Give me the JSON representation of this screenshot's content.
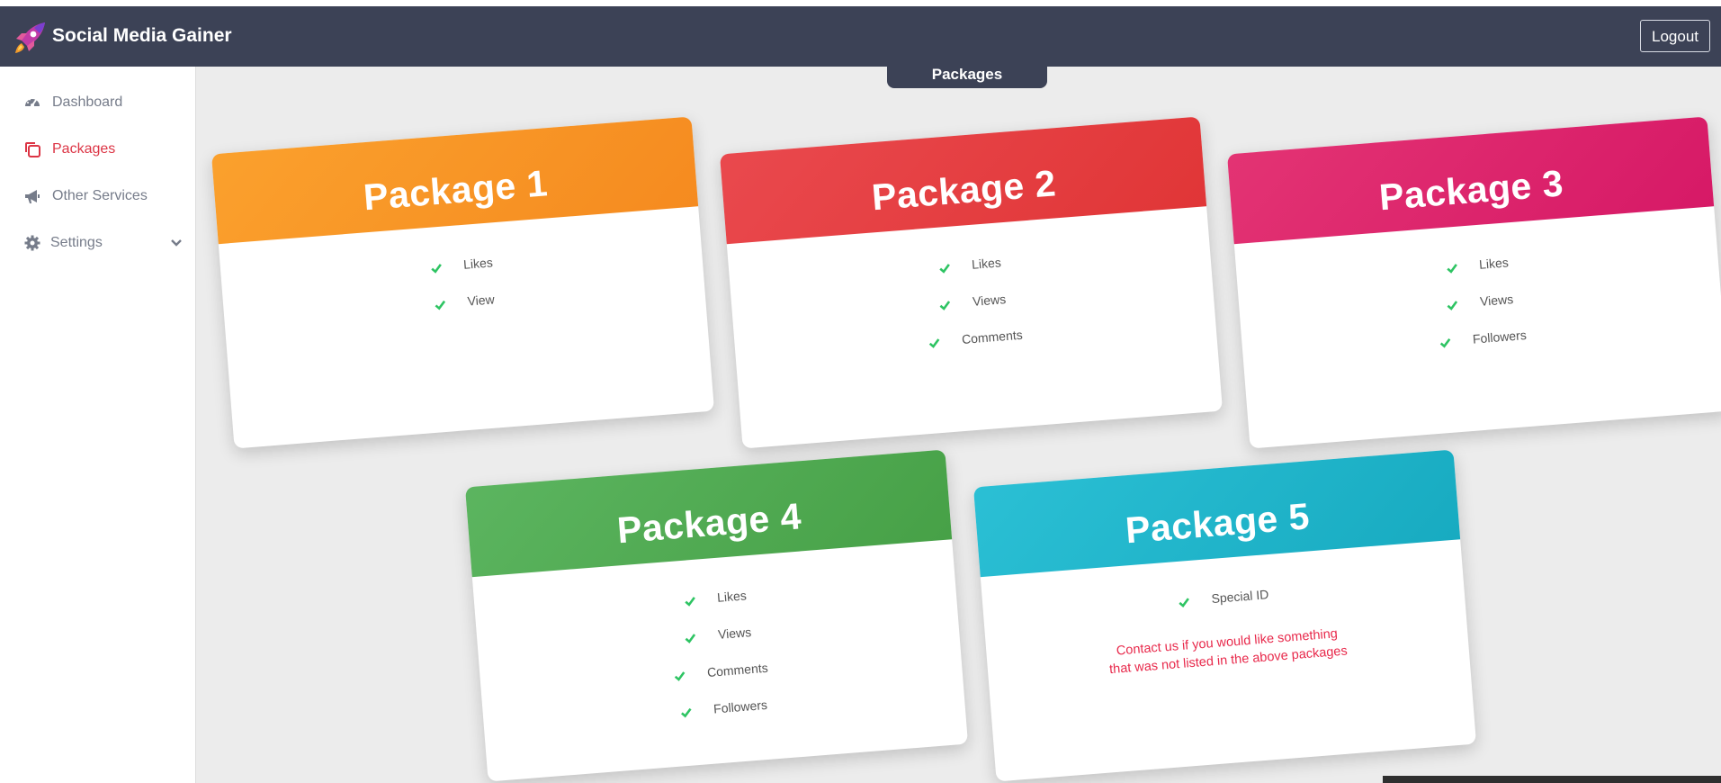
{
  "app": {
    "title": "Social Media Gainer",
    "logout_label": "Logout"
  },
  "page_tab": {
    "label": "Packages"
  },
  "sidebar": {
    "items": [
      {
        "label": "Dashboard",
        "icon": "dashboard-icon"
      },
      {
        "label": "Packages",
        "icon": "packages-icon",
        "active": true
      },
      {
        "label": "Other Services",
        "icon": "megaphone-icon"
      },
      {
        "label": "Settings",
        "icon": "gear-icon",
        "expandable": true
      }
    ]
  },
  "packages": [
    {
      "title": "Package 1",
      "color_from": "#fba22e",
      "color_to": "#f58a1f",
      "features": [
        "Likes",
        "View"
      ]
    },
    {
      "title": "Package 2",
      "color_from": "#ea4a4f",
      "color_to": "#e03536",
      "features": [
        "Likes",
        "Views",
        "Comments"
      ]
    },
    {
      "title": "Package 3",
      "color_from": "#e43574",
      "color_to": "#d61866",
      "features": [
        "Likes",
        "Views",
        "Followers"
      ]
    },
    {
      "title": "Package 4",
      "color_from": "#5db661",
      "color_to": "#46a046",
      "features": [
        "Likes",
        "Views",
        "Comments",
        "Followers"
      ]
    },
    {
      "title": "Package 5",
      "color_from": "#2cc1d6",
      "color_to": "#17aac0",
      "features": [
        "Special ID"
      ],
      "note_line1": "Contact us if you would like something",
      "note_line2": "that was not listed in the above packages"
    }
  ],
  "colors": {
    "topbar": "#3c4256",
    "active": "#dc3545",
    "check": "#2ec463"
  }
}
